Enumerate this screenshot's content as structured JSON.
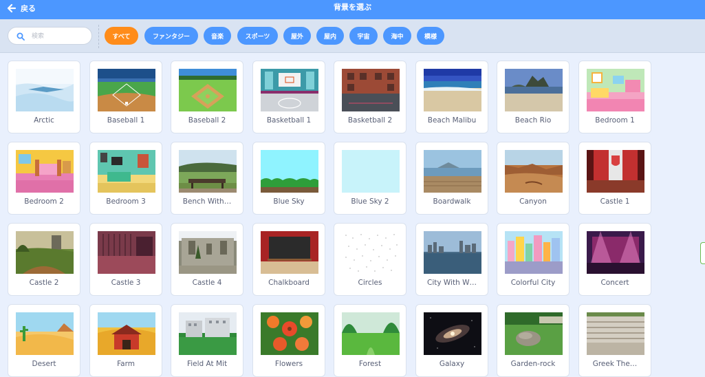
{
  "header": {
    "back_label": "戻る",
    "title": "背景を選ぶ"
  },
  "search": {
    "placeholder": "検索",
    "value": ""
  },
  "tags": [
    {
      "label": "すべて",
      "active": true
    },
    {
      "label": "ファンタジー",
      "active": false
    },
    {
      "label": "音楽",
      "active": false
    },
    {
      "label": "スポーツ",
      "active": false
    },
    {
      "label": "屋外",
      "active": false
    },
    {
      "label": "屋内",
      "active": false
    },
    {
      "label": "宇宙",
      "active": false
    },
    {
      "label": "海中",
      "active": false
    },
    {
      "label": "模様",
      "active": false
    }
  ],
  "backdrops": [
    {
      "name": "Arctic",
      "art": "arctic"
    },
    {
      "name": "Baseball 1",
      "art": "baseball1"
    },
    {
      "name": "Baseball 2",
      "art": "baseball2"
    },
    {
      "name": "Basketball 1",
      "art": "basketball1"
    },
    {
      "name": "Basketball 2",
      "art": "basketball2"
    },
    {
      "name": "Beach Malibu",
      "art": "beach"
    },
    {
      "name": "Beach Rio",
      "art": "rio"
    },
    {
      "name": "Bedroom 1",
      "art": "bedroom1"
    },
    {
      "name": "Bedroom 2",
      "art": "bedroom2"
    },
    {
      "name": "Bedroom 3",
      "art": "bedroom3"
    },
    {
      "name": "Bench With…",
      "art": "bench"
    },
    {
      "name": "Blue Sky",
      "art": "bluesky"
    },
    {
      "name": "Blue Sky 2",
      "art": "bluesky2"
    },
    {
      "name": "Boardwalk",
      "art": "boardwalk"
    },
    {
      "name": "Canyon",
      "art": "canyon"
    },
    {
      "name": "Castle 1",
      "art": "castle1"
    },
    {
      "name": "Castle 2",
      "art": "castle2"
    },
    {
      "name": "Castle 3",
      "art": "castle3"
    },
    {
      "name": "Castle 4",
      "art": "castle4"
    },
    {
      "name": "Chalkboard",
      "art": "chalkboard"
    },
    {
      "name": "Circles",
      "art": "circles"
    },
    {
      "name": "City With W…",
      "art": "citywater"
    },
    {
      "name": "Colorful City",
      "art": "colorfulcity"
    },
    {
      "name": "Concert",
      "art": "concert"
    },
    {
      "name": "Desert",
      "art": "desert"
    },
    {
      "name": "Farm",
      "art": "farm"
    },
    {
      "name": "Field At Mit",
      "art": "field"
    },
    {
      "name": "Flowers",
      "art": "flowers"
    },
    {
      "name": "Forest",
      "art": "forest"
    },
    {
      "name": "Galaxy",
      "art": "galaxy"
    },
    {
      "name": "Garden-rock",
      "art": "gardenrock"
    },
    {
      "name": "Greek The…",
      "art": "greek"
    }
  ],
  "colors": {
    "accent": "#4c97ff",
    "active_tag": "#ff8c1a",
    "filter_bar": "#d9e3f2",
    "background": "#e9f0fd"
  }
}
